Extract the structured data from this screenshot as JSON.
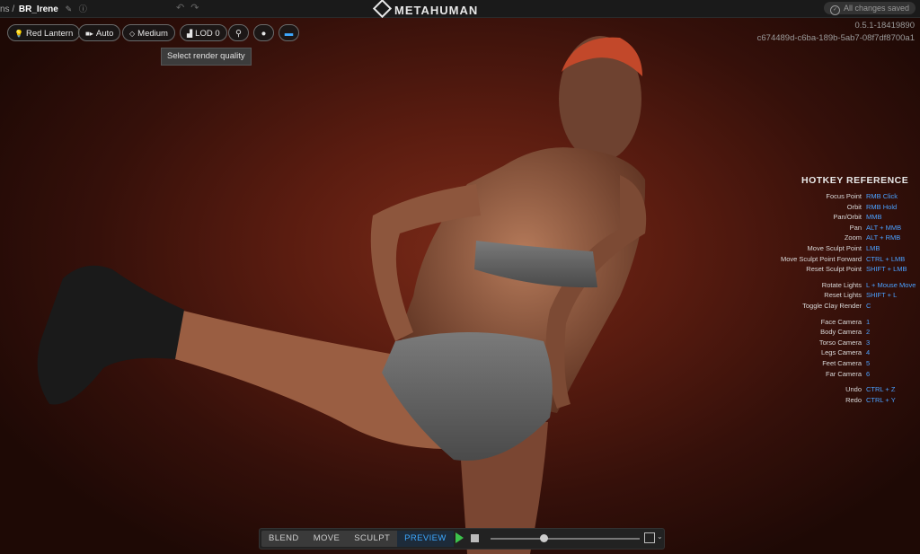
{
  "topbar": {
    "breadcrumb_prefix": "ns /",
    "character_name": "BR_Irene",
    "brand": "METAHUMAN",
    "save_status": "All changes saved"
  },
  "version": {
    "number": "0.5.1-18419890",
    "hash": "c674489d-c6ba-189b-5ab7-08f7df8700a1"
  },
  "toolbar": {
    "lighting": "Red Lantern",
    "camera": "Auto",
    "quality": "Medium",
    "lod": "LOD 0"
  },
  "tooltip": "Select render quality",
  "hotkeys": {
    "title": "HOTKEY REFERENCE",
    "groups": [
      [
        {
          "action": "Focus Point",
          "key": "RMB Click"
        },
        {
          "action": "Orbit",
          "key": "RMB Hold"
        },
        {
          "action": "Pan/Orbit",
          "key": "MMB"
        },
        {
          "action": "Pan",
          "key": "ALT + MMB"
        },
        {
          "action": "Zoom",
          "key": "ALT + RMB"
        },
        {
          "action": "Move Sculpt Point",
          "key": "LMB"
        },
        {
          "action": "Move Sculpt Point Forward",
          "key": "CTRL + LMB"
        },
        {
          "action": "Reset Sculpt Point",
          "key": "SHIFT + LMB"
        }
      ],
      [
        {
          "action": "Rotate Lights",
          "key": "L + Mouse Move"
        },
        {
          "action": "Reset Lights",
          "key": "SHIFT + L"
        },
        {
          "action": "Toggle Clay Render",
          "key": "C"
        }
      ],
      [
        {
          "action": "Face Camera",
          "key": "1"
        },
        {
          "action": "Body Camera",
          "key": "2"
        },
        {
          "action": "Torso Camera",
          "key": "3"
        },
        {
          "action": "Legs Camera",
          "key": "4"
        },
        {
          "action": "Feet Camera",
          "key": "5"
        },
        {
          "action": "Far Camera",
          "key": "6"
        }
      ],
      [
        {
          "action": "Undo",
          "key": "CTRL + Z"
        },
        {
          "action": "Redo",
          "key": "CTRL + Y"
        }
      ]
    ]
  },
  "modes": [
    "BLEND",
    "MOVE",
    "SCULPT",
    "PREVIEW"
  ],
  "active_mode": "PREVIEW",
  "playback": {
    "progress": 0.36
  },
  "colors": {
    "accent": "#3da8ff",
    "hotkey": "#4aa0ff",
    "play": "#3cc24c",
    "background": "#5a1c10"
  }
}
